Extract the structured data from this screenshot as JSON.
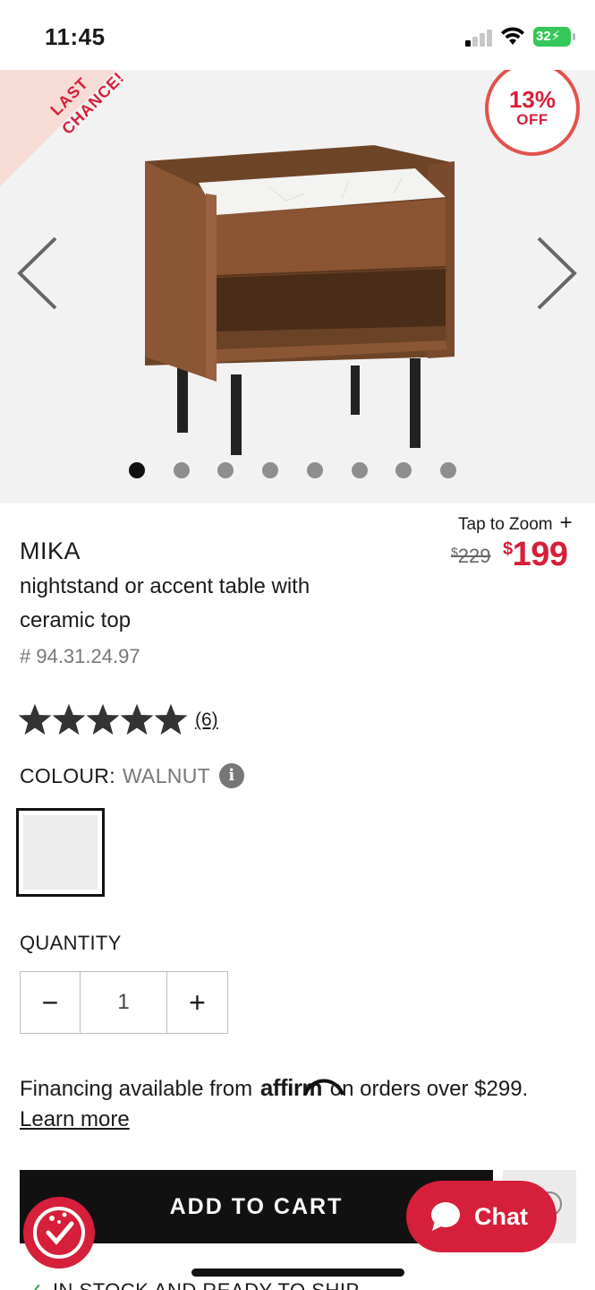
{
  "status_bar": {
    "time": "11:45",
    "battery": "32"
  },
  "hero": {
    "ribbon_line1": "LAST",
    "ribbon_line2": "CHANCE!",
    "discount_pct": "13%",
    "discount_off": "OFF",
    "image_count": 8,
    "active_image": 1
  },
  "product": {
    "tap_to_zoom": "Tap to Zoom",
    "price_old": "229",
    "price_new": "199",
    "currency": "$",
    "name": "MIKA",
    "description": "nightstand or accent table with ceramic top",
    "sku": "# 94.31.24.97",
    "rating": 5,
    "review_count": "(6)",
    "colour_label": "COLOUR:",
    "colour_value": "WALNUT"
  },
  "quantity": {
    "label": "QUANTITY",
    "value": "1",
    "decrement": "−",
    "increment": "+"
  },
  "financing": {
    "prefix": "Financing available from",
    "brand": "affirm",
    "suffix": "on orders over $299.",
    "learn_more": "Learn more"
  },
  "actions": {
    "add_to_cart": "ADD TO CART",
    "chat": "Chat"
  },
  "stock": {
    "text": "IN STOCK AND READY TO SHIP"
  },
  "colors": {
    "accent": "#d61f3a",
    "dark": "#111111",
    "muted": "#777777"
  }
}
